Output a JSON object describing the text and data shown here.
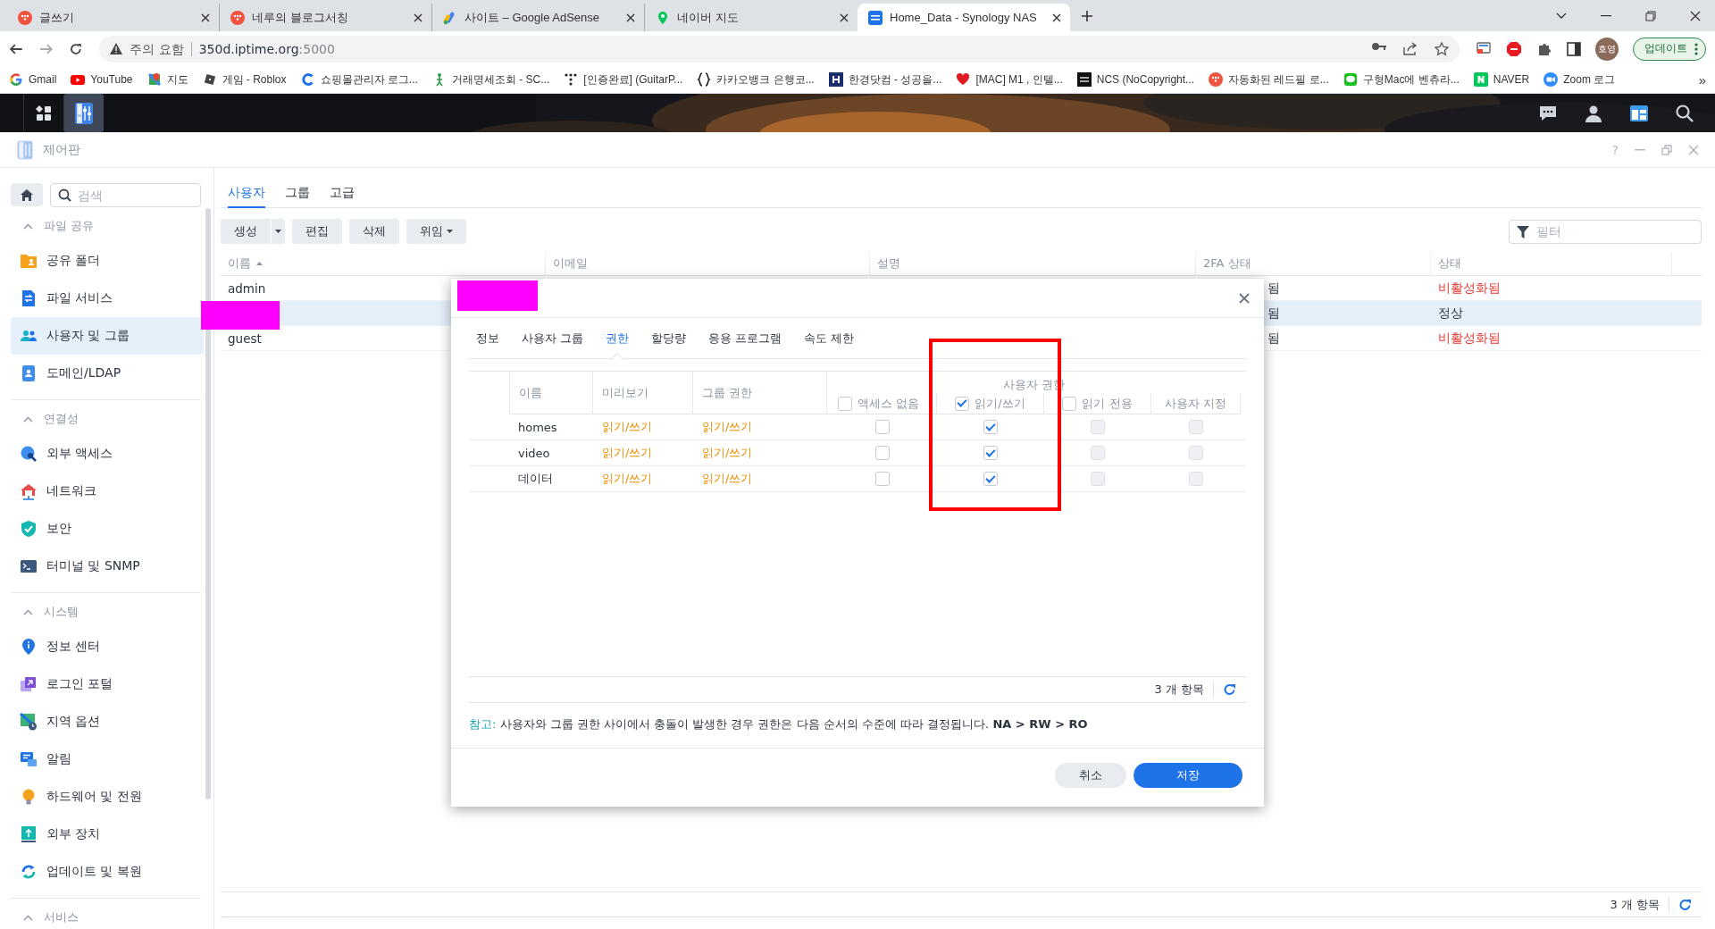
{
  "browser": {
    "tabs": [
      {
        "title": "글쓰기",
        "kind": "dots",
        "selected": false
      },
      {
        "title": "네루의 블로그서칭",
        "kind": "dots",
        "selected": false
      },
      {
        "title": "사이트 – Google AdSense",
        "kind": "ads",
        "selected": false
      },
      {
        "title": "네이버 지도",
        "kind": "pin",
        "selected": false
      },
      {
        "title": "Home_Data - Synology NAS",
        "kind": "app",
        "selected": true
      }
    ],
    "security_label": "주의 요함",
    "url": {
      "host": "350d.iptime.org",
      "port": ":5000"
    },
    "profile": "호영",
    "update_button": "업데이트",
    "bookmarks": [
      {
        "label": "Gmail",
        "kind": "g"
      },
      {
        "label": "YouTube",
        "kind": "play"
      },
      {
        "label": "지도",
        "kind": "mappin"
      },
      {
        "label": "게임 - Roblox",
        "kind": "tilted"
      },
      {
        "label": "쇼핑몰관리자 로그...",
        "kind": "c"
      },
      {
        "label": "거래명세조회 - SC...",
        "kind": "figure"
      },
      {
        "label": "[인증완료] (GuitarP...",
        "kind": "dotgrid"
      },
      {
        "label": "카카오뱅크 은행코...",
        "kind": "braces"
      },
      {
        "label": "한경닷컴 - 성공을...",
        "kind": "navy"
      },
      {
        "label": "[MAC] M1 , 인텔...",
        "kind": "heart"
      },
      {
        "label": "NCS (NoCopyright...",
        "kind": "black"
      },
      {
        "label": "자동화된 레드필 로...",
        "kind": "dots"
      },
      {
        "label": "구형Mac에 벤츄라...",
        "kind": "bubble"
      },
      {
        "label": "NAVER",
        "kind": "greensq"
      },
      {
        "label": "Zoom 로그",
        "kind": "cam"
      }
    ],
    "more_bookmarks": "»"
  },
  "window": {
    "title": "제어판",
    "help": "?"
  },
  "sidebar": {
    "search": {
      "placeholder": "검색"
    },
    "sections": [
      {
        "title": "파일 공유",
        "expanded": true,
        "items": [
          {
            "label": "공유 폴더",
            "kind": "folder",
            "selected": false
          },
          {
            "label": "파일 서비스",
            "kind": "file_service",
            "selected": false
          },
          {
            "label": "사용자 및 그룹",
            "kind": "users",
            "selected": true
          },
          {
            "label": "도메인/LDAP",
            "kind": "ldap",
            "selected": false
          }
        ]
      },
      {
        "title": "연결성",
        "expanded": true,
        "items": [
          {
            "label": "외부 액세스",
            "kind": "external",
            "selected": false
          },
          {
            "label": "네트워크",
            "kind": "network",
            "selected": false
          },
          {
            "label": "보안",
            "kind": "security",
            "selected": false
          },
          {
            "label": "터미널 및 SNMP",
            "kind": "terminal",
            "selected": false
          }
        ]
      },
      {
        "title": "시스템",
        "expanded": true,
        "items": [
          {
            "label": "정보 센터",
            "kind": "info",
            "selected": false
          },
          {
            "label": "로그인 포털",
            "kind": "login",
            "selected": false
          },
          {
            "label": "지역 옵션",
            "kind": "regional",
            "selected": false
          },
          {
            "label": "알림",
            "kind": "notification",
            "selected": false
          },
          {
            "label": "하드웨어 및 전원",
            "kind": "hardware",
            "selected": false
          },
          {
            "label": "외부 장치",
            "kind": "external_devices",
            "selected": false
          },
          {
            "label": "업데이트 및 복원",
            "kind": "update",
            "selected": false
          }
        ]
      },
      {
        "title": "서비스",
        "expanded": true
      }
    ]
  },
  "main": {
    "tabs": [
      {
        "label": "사용자",
        "selected": true
      },
      {
        "label": "그룹",
        "selected": false
      },
      {
        "label": "고급",
        "selected": false
      }
    ],
    "toolbar": {
      "buttons": [
        {
          "label": "생성",
          "kind": "split"
        },
        {
          "label": "편집",
          "kind": "plain"
        },
        {
          "label": "삭제",
          "kind": "plain"
        },
        {
          "label": "위임",
          "kind": "menu"
        }
      ],
      "filter": {
        "placeholder": "필터"
      }
    },
    "table": {
      "columns": [
        {
          "label": "이름",
          "sorted": true
        },
        {
          "label": "이메일",
          "sorted": false
        },
        {
          "label": "설명",
          "sorted": false
        },
        {
          "label": "2FA 상태",
          "sorted": false
        },
        {
          "label": "상태",
          "sorted": false
        }
      ],
      "rows": [
        {
          "name": "admin",
          "redacted": false,
          "two_fa": "됨",
          "status": "비활성화됨",
          "inactive": true,
          "selected": false
        },
        {
          "redacted": true,
          "two_fa": "됨",
          "status": "정상",
          "inactive": false,
          "selected": true
        },
        {
          "name": "guest",
          "redacted": false,
          "two_fa": "됨",
          "status": "비활성화됨",
          "inactive": true,
          "selected": false
        }
      ]
    },
    "count": "3 개 항목"
  },
  "dialog": {
    "title_redacted": true,
    "tabs": [
      {
        "label": "정보",
        "selected": false
      },
      {
        "label": "사용자 그룹",
        "selected": false
      },
      {
        "label": "권한",
        "selected": true
      },
      {
        "label": "할당량",
        "selected": false
      },
      {
        "label": "응용 프로그램",
        "selected": false
      },
      {
        "label": "속도 제한",
        "selected": false
      }
    ],
    "columns": {
      "name": "이름",
      "preview": "미리보기",
      "group": "그룹 권한",
      "user_permission": "사용자 권한",
      "permissions": [
        {
          "label": "액세스 없음",
          "kind": "checkbox",
          "checked": false
        },
        {
          "label": "읽기/쓰기",
          "kind": "checkbox",
          "checked": true
        },
        {
          "label": "읽기 전용",
          "kind": "checkbox",
          "checked": false
        },
        {
          "label": "사용자 지정",
          "kind": "plain"
        }
      ]
    },
    "rows": [
      {
        "name": "homes",
        "preview": "읽기/쓰기",
        "group": "읽기/쓰기",
        "permissions": [
          {
            "checked": false,
            "disabled": false
          },
          {
            "checked": true,
            "disabled": false
          },
          {
            "checked": false,
            "disabled": true
          },
          {
            "checked": false,
            "disabled": true
          }
        ]
      },
      {
        "name": "video",
        "preview": "읽기/쓰기",
        "group": "읽기/쓰기",
        "permissions": [
          {
            "checked": false,
            "disabled": false
          },
          {
            "checked": true,
            "disabled": false
          },
          {
            "checked": false,
            "disabled": true
          },
          {
            "checked": false,
            "disabled": true
          }
        ]
      },
      {
        "name": "데이터",
        "preview": "읽기/쓰기",
        "group": "읽기/쓰기",
        "permissions": [
          {
            "checked": false,
            "disabled": false
          },
          {
            "checked": true,
            "disabled": false
          },
          {
            "checked": false,
            "disabled": true
          },
          {
            "checked": false,
            "disabled": true
          }
        ]
      }
    ],
    "count": "3 개 항목",
    "note_label": "참고:",
    "note": "사용자와 그룹 권한 사이에서 충돌이 발생한 경우 권한은 다음 순서의 수준에 따라 결정됩니다. **NA > RW > RO**",
    "buttons": [
      {
        "label": "취소",
        "kind": "secondary"
      },
      {
        "label": "저장",
        "kind": "primary"
      }
    ]
  }
}
